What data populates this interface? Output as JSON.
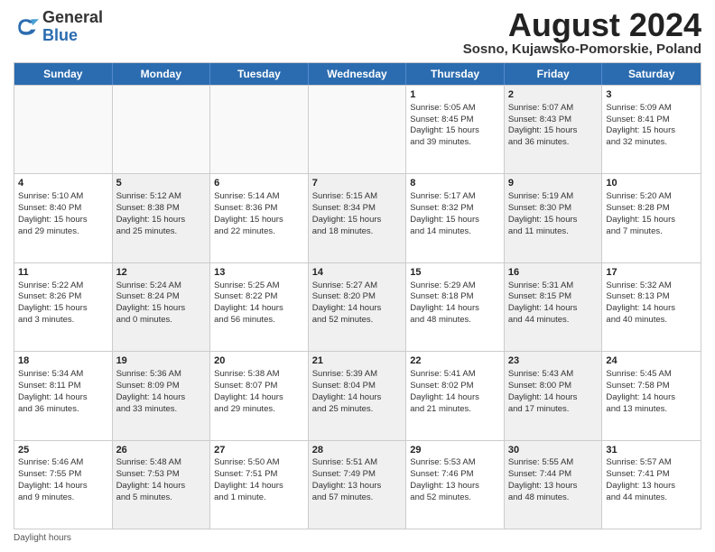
{
  "header": {
    "logo": {
      "general": "General",
      "blue": "Blue"
    },
    "title": "August 2024",
    "location": "Sosno, Kujawsko-Pomorskie, Poland"
  },
  "weekdays": [
    "Sunday",
    "Monday",
    "Tuesday",
    "Wednesday",
    "Thursday",
    "Friday",
    "Saturday"
  ],
  "weeks": [
    [
      {
        "day": "",
        "info": "",
        "empty": true
      },
      {
        "day": "",
        "info": "",
        "empty": true
      },
      {
        "day": "",
        "info": "",
        "empty": true
      },
      {
        "day": "",
        "info": "",
        "empty": true
      },
      {
        "day": "1",
        "info": "Sunrise: 5:05 AM\nSunset: 8:45 PM\nDaylight: 15 hours\nand 39 minutes.",
        "empty": false
      },
      {
        "day": "2",
        "info": "Sunrise: 5:07 AM\nSunset: 8:43 PM\nDaylight: 15 hours\nand 36 minutes.",
        "empty": false,
        "shaded": true
      },
      {
        "day": "3",
        "info": "Sunrise: 5:09 AM\nSunset: 8:41 PM\nDaylight: 15 hours\nand 32 minutes.",
        "empty": false
      }
    ],
    [
      {
        "day": "4",
        "info": "Sunrise: 5:10 AM\nSunset: 8:40 PM\nDaylight: 15 hours\nand 29 minutes.",
        "empty": false
      },
      {
        "day": "5",
        "info": "Sunrise: 5:12 AM\nSunset: 8:38 PM\nDaylight: 15 hours\nand 25 minutes.",
        "empty": false,
        "shaded": true
      },
      {
        "day": "6",
        "info": "Sunrise: 5:14 AM\nSunset: 8:36 PM\nDaylight: 15 hours\nand 22 minutes.",
        "empty": false
      },
      {
        "day": "7",
        "info": "Sunrise: 5:15 AM\nSunset: 8:34 PM\nDaylight: 15 hours\nand 18 minutes.",
        "empty": false,
        "shaded": true
      },
      {
        "day": "8",
        "info": "Sunrise: 5:17 AM\nSunset: 8:32 PM\nDaylight: 15 hours\nand 14 minutes.",
        "empty": false
      },
      {
        "day": "9",
        "info": "Sunrise: 5:19 AM\nSunset: 8:30 PM\nDaylight: 15 hours\nand 11 minutes.",
        "empty": false,
        "shaded": true
      },
      {
        "day": "10",
        "info": "Sunrise: 5:20 AM\nSunset: 8:28 PM\nDaylight: 15 hours\nand 7 minutes.",
        "empty": false
      }
    ],
    [
      {
        "day": "11",
        "info": "Sunrise: 5:22 AM\nSunset: 8:26 PM\nDaylight: 15 hours\nand 3 minutes.",
        "empty": false
      },
      {
        "day": "12",
        "info": "Sunrise: 5:24 AM\nSunset: 8:24 PM\nDaylight: 15 hours\nand 0 minutes.",
        "empty": false,
        "shaded": true
      },
      {
        "day": "13",
        "info": "Sunrise: 5:25 AM\nSunset: 8:22 PM\nDaylight: 14 hours\nand 56 minutes.",
        "empty": false
      },
      {
        "day": "14",
        "info": "Sunrise: 5:27 AM\nSunset: 8:20 PM\nDaylight: 14 hours\nand 52 minutes.",
        "empty": false,
        "shaded": true
      },
      {
        "day": "15",
        "info": "Sunrise: 5:29 AM\nSunset: 8:18 PM\nDaylight: 14 hours\nand 48 minutes.",
        "empty": false
      },
      {
        "day": "16",
        "info": "Sunrise: 5:31 AM\nSunset: 8:15 PM\nDaylight: 14 hours\nand 44 minutes.",
        "empty": false,
        "shaded": true
      },
      {
        "day": "17",
        "info": "Sunrise: 5:32 AM\nSunset: 8:13 PM\nDaylight: 14 hours\nand 40 minutes.",
        "empty": false
      }
    ],
    [
      {
        "day": "18",
        "info": "Sunrise: 5:34 AM\nSunset: 8:11 PM\nDaylight: 14 hours\nand 36 minutes.",
        "empty": false
      },
      {
        "day": "19",
        "info": "Sunrise: 5:36 AM\nSunset: 8:09 PM\nDaylight: 14 hours\nand 33 minutes.",
        "empty": false,
        "shaded": true
      },
      {
        "day": "20",
        "info": "Sunrise: 5:38 AM\nSunset: 8:07 PM\nDaylight: 14 hours\nand 29 minutes.",
        "empty": false
      },
      {
        "day": "21",
        "info": "Sunrise: 5:39 AM\nSunset: 8:04 PM\nDaylight: 14 hours\nand 25 minutes.",
        "empty": false,
        "shaded": true
      },
      {
        "day": "22",
        "info": "Sunrise: 5:41 AM\nSunset: 8:02 PM\nDaylight: 14 hours\nand 21 minutes.",
        "empty": false
      },
      {
        "day": "23",
        "info": "Sunrise: 5:43 AM\nSunset: 8:00 PM\nDaylight: 14 hours\nand 17 minutes.",
        "empty": false,
        "shaded": true
      },
      {
        "day": "24",
        "info": "Sunrise: 5:45 AM\nSunset: 7:58 PM\nDaylight: 14 hours\nand 13 minutes.",
        "empty": false
      }
    ],
    [
      {
        "day": "25",
        "info": "Sunrise: 5:46 AM\nSunset: 7:55 PM\nDaylight: 14 hours\nand 9 minutes.",
        "empty": false
      },
      {
        "day": "26",
        "info": "Sunrise: 5:48 AM\nSunset: 7:53 PM\nDaylight: 14 hours\nand 5 minutes.",
        "empty": false,
        "shaded": true
      },
      {
        "day": "27",
        "info": "Sunrise: 5:50 AM\nSunset: 7:51 PM\nDaylight: 14 hours\nand 1 minute.",
        "empty": false
      },
      {
        "day": "28",
        "info": "Sunrise: 5:51 AM\nSunset: 7:49 PM\nDaylight: 13 hours\nand 57 minutes.",
        "empty": false,
        "shaded": true
      },
      {
        "day": "29",
        "info": "Sunrise: 5:53 AM\nSunset: 7:46 PM\nDaylight: 13 hours\nand 52 minutes.",
        "empty": false
      },
      {
        "day": "30",
        "info": "Sunrise: 5:55 AM\nSunset: 7:44 PM\nDaylight: 13 hours\nand 48 minutes.",
        "empty": false,
        "shaded": true
      },
      {
        "day": "31",
        "info": "Sunrise: 5:57 AM\nSunset: 7:41 PM\nDaylight: 13 hours\nand 44 minutes.",
        "empty": false
      }
    ]
  ],
  "footer": {
    "daylight_label": "Daylight hours"
  }
}
